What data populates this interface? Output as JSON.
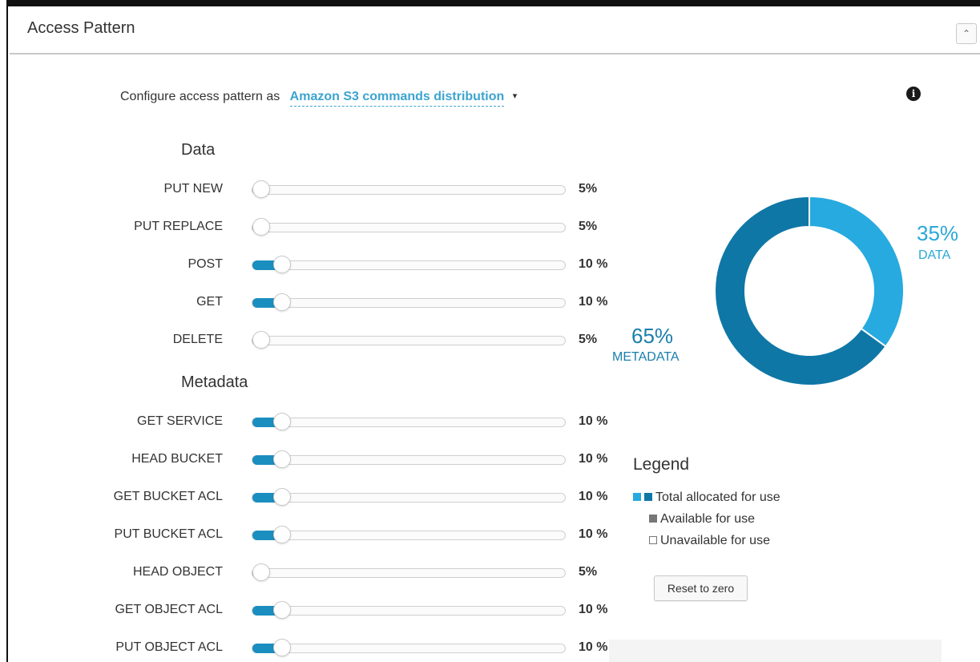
{
  "panel": {
    "title": "Access Pattern",
    "collapse_icon": "double-chevron-up-icon"
  },
  "configure": {
    "prefix": "Configure access pattern as",
    "selected": "Amazon S3 commands distribution",
    "caret": "▾"
  },
  "info_icon": "i",
  "sections": [
    {
      "heading": "Data",
      "items": [
        {
          "label": "PUT NEW",
          "value": "5%",
          "percent": 5
        },
        {
          "label": "PUT REPLACE",
          "value": "5%",
          "percent": 5
        },
        {
          "label": "POST",
          "value": "10 %",
          "percent": 10
        },
        {
          "label": "GET",
          "value": "10 %",
          "percent": 10
        },
        {
          "label": "DELETE",
          "value": "5%",
          "percent": 5
        }
      ]
    },
    {
      "heading": "Metadata",
      "items": [
        {
          "label": "GET SERVICE",
          "value": "10 %",
          "percent": 10
        },
        {
          "label": "HEAD BUCKET",
          "value": "10 %",
          "percent": 10
        },
        {
          "label": "GET BUCKET ACL",
          "value": "10 %",
          "percent": 10
        },
        {
          "label": "PUT BUCKET ACL",
          "value": "10 %",
          "percent": 10
        },
        {
          "label": "HEAD OBJECT",
          "value": "5%",
          "percent": 5
        },
        {
          "label": "GET OBJECT ACL",
          "value": "10 %",
          "percent": 10
        },
        {
          "label": "PUT OBJECT ACL",
          "value": "10 %",
          "percent": 10
        }
      ]
    }
  ],
  "donut": {
    "data_percent": 35,
    "metadata_percent": 65,
    "data_pct_label": "35%",
    "data_label": "DATA",
    "metadata_pct_label": "65%",
    "metadata_label": "METADATA",
    "data_color": "#27aadf",
    "metadata_color": "#0f77a6"
  },
  "legend": {
    "title": "Legend",
    "items": [
      {
        "label": "Total allocated for use"
      },
      {
        "label": "Available for use"
      },
      {
        "label": "Unavailable for use"
      }
    ]
  },
  "reset_label": "Reset to zero"
}
